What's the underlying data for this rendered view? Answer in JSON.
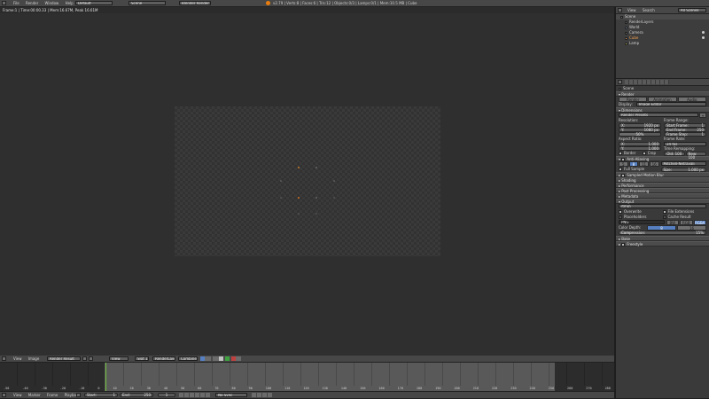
{
  "top_menu": {
    "items": [
      "File",
      "Render",
      "Window",
      "Help"
    ],
    "layout": "Default",
    "scene": "Scene",
    "engine": "Blender Render",
    "status": "v2.79 | Verts:8 | Faces:6 | Tris:12 | Objects:0/3 | Lamps:0/1 | Mem:10.5 MB | Cube"
  },
  "image_header": {
    "info": "Frame:1 | Time:00:00.33 | Mem:16.67M, Peak 16.61M"
  },
  "outliner": {
    "header": [
      "View",
      "Search",
      "All Scenes"
    ],
    "items": [
      "Scene",
      "RenderLayers",
      "World",
      "Camera",
      "Cube",
      "Lamp"
    ]
  },
  "properties": {
    "context": "Scene",
    "render_label": "Render",
    "render_buttons": [
      "Render",
      "Animation",
      "Audio"
    ],
    "display_label": "Display:",
    "display_value": "Image Editor",
    "dimensions_label": "Dimensions",
    "presets": "Render Presets",
    "resolution_label": "Resolution:",
    "res_x": [
      "X:",
      "1920 px"
    ],
    "res_y": [
      "Y:",
      "1080 px"
    ],
    "res_pct": "50%",
    "frame_range_label": "Frame Range:",
    "start_frame": [
      "Start Frame:",
      "1"
    ],
    "end_frame": [
      "End Frame:",
      "250"
    ],
    "frame_step": [
      "Frame Step:",
      "1"
    ],
    "aspect_label": "Aspect Ratio:",
    "aspect_x": [
      "X:",
      "1.000"
    ],
    "aspect_y": [
      "Y:",
      "1.000"
    ],
    "frame_rate_label": "Frame Rate:",
    "fps": "24 fps",
    "time_remap_label": "Time Remapping:",
    "time_old": "Old: 100",
    "time_new": "New: 100",
    "border": "Border",
    "crop": "Crop",
    "aa_label": "Anti-Aliasing",
    "aa_samples": [
      "5",
      "8",
      "11",
      "16"
    ],
    "aa_filter": "Mitchell-Netravali",
    "full_sample": "Full Sample",
    "aa_size": [
      "Size:",
      "1.000 px"
    ],
    "panels": [
      "Sampled Motion Blur",
      "Shading",
      "Performance",
      "Post Processing",
      "Metadata"
    ],
    "output_label": "Output",
    "output_path": "/tmp\\",
    "overwrite": "Overwrite",
    "file_extensions": "File Extensions",
    "placeholders": "Placeholders",
    "cache_result": "Cache Result",
    "file_format": "PNG",
    "color_modes": [
      "BW",
      "RGB",
      "RGBA"
    ],
    "color_depth_label": "Color Depth:",
    "color_depth_values": [
      "8",
      "16"
    ],
    "compression_label": "Compression:",
    "compression_value": "15%",
    "bake_label": "Bake",
    "freestyle_label": "Freestyle"
  },
  "image_editor_header": {
    "items": [
      "View",
      "Image"
    ],
    "image_name": "Render Result",
    "view_label": "View",
    "slot": "Slot 1",
    "layer": "RenderLayer",
    "pass": "Combined"
  },
  "timeline": {
    "ruler": [
      "-50",
      "-40",
      "-30",
      "-20",
      "-10",
      "0",
      "10",
      "20",
      "30",
      "40",
      "50",
      "60",
      "70",
      "80",
      "90",
      "100",
      "110",
      "120",
      "130",
      "140",
      "150",
      "160",
      "170",
      "180",
      "190",
      "200",
      "210",
      "220",
      "230",
      "240",
      "250",
      "260",
      "270",
      "280"
    ],
    "current_frame": 1,
    "footer_menu": [
      "View",
      "Marker",
      "Frame",
      "Playback"
    ],
    "start": "Start:",
    "start_value": "1",
    "end": "End:",
    "end_value": "250",
    "current": "1",
    "sync": "No Sync"
  }
}
